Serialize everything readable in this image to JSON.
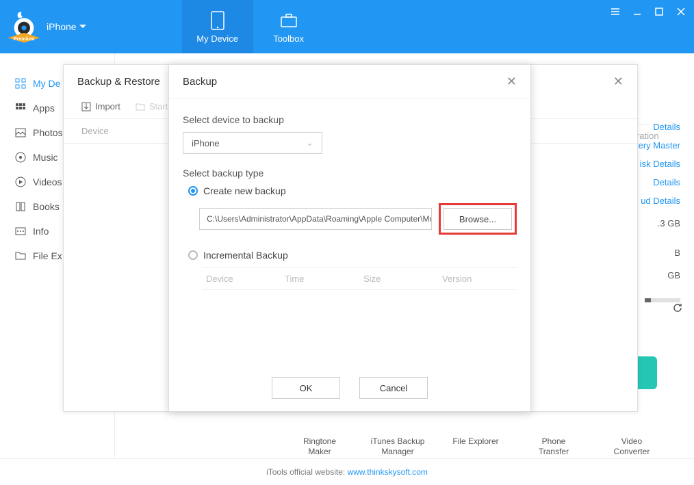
{
  "header": {
    "device_selector": "iPhone",
    "tabs": {
      "my_device": "My Device",
      "toolbox": "Toolbox"
    }
  },
  "sidebar": {
    "items": [
      {
        "label": "My De"
      },
      {
        "label": "Apps"
      },
      {
        "label": "Photos"
      },
      {
        "label": "Music"
      },
      {
        "label": "Videos"
      },
      {
        "label": "Books"
      },
      {
        "label": "Info"
      },
      {
        "label": "File Ex"
      }
    ]
  },
  "right_panel": {
    "op_header": "Operation",
    "links": [
      "Details",
      "ery Master",
      "isk Details",
      "Details",
      "ud Details"
    ],
    "storage_values": [
      ".3 GB",
      "B",
      " GB"
    ]
  },
  "toolbox_row": [
    "Ringtone Maker",
    "iTunes Backup Manager",
    "File Explorer",
    "Phone Transfer",
    "Video Converter"
  ],
  "footer": {
    "text": "iTools official website: ",
    "link": "www.thinkskysoft.com"
  },
  "modal1": {
    "title": "Backup & Restore",
    "toolbar": {
      "import": "Import",
      "start": "Start"
    },
    "col1": "Device"
  },
  "modal2": {
    "title": "Backup",
    "section1_label": "Select device to backup",
    "device_value": "iPhone",
    "section2_label": "Select backup type",
    "radio1": "Create new backup",
    "path": "C:\\Users\\Administrator\\AppData\\Roaming\\Apple Computer\\Mo",
    "browse": "Browse...",
    "radio2": "Incremental Backup",
    "inc_cols": {
      "device": "Device",
      "time": "Time",
      "size": "Size",
      "version": "Version"
    },
    "ok": "OK",
    "cancel": "Cancel"
  }
}
